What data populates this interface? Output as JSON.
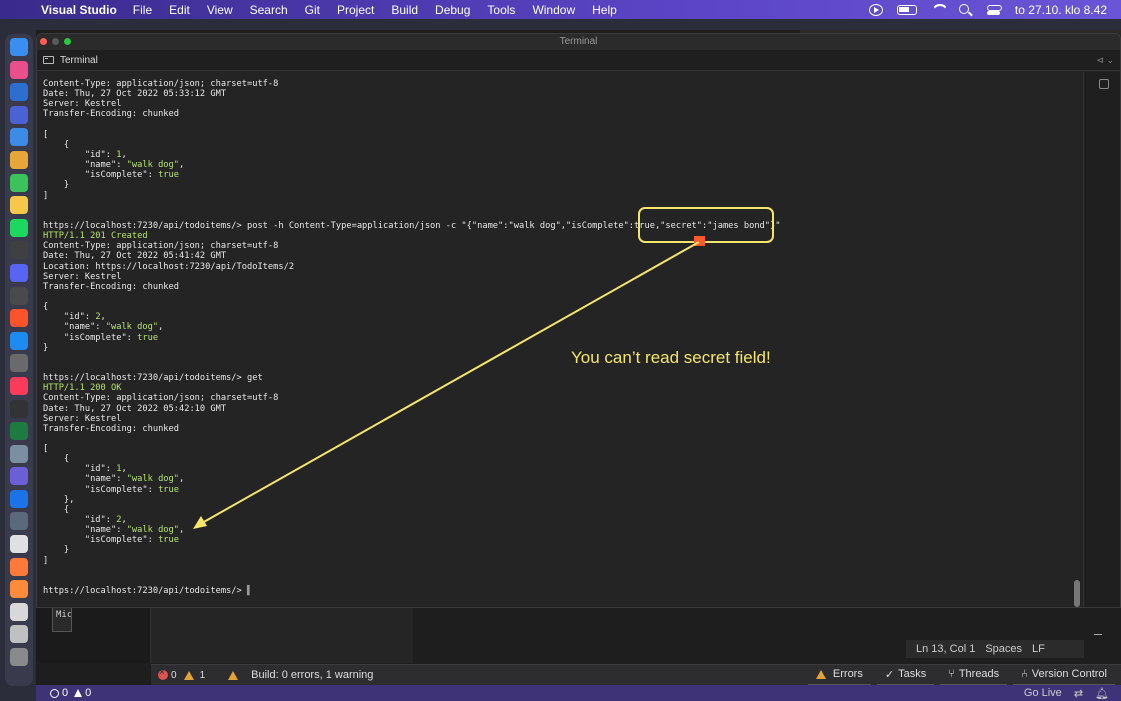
{
  "menubar": {
    "app_name": "Visual Studio",
    "items": [
      "File",
      "Edit",
      "View",
      "Search",
      "Git",
      "Project",
      "Build",
      "Debug",
      "Tools",
      "Window",
      "Help"
    ],
    "clock": "to 27.10. klo 8.42"
  },
  "dock": {
    "colors": [
      "#3a8ef0",
      "#e94f8b",
      "#2d6fd1",
      "#4b62d6",
      "#3c8be5",
      "#e6a73a",
      "#3bc25b",
      "#f5c84a",
      "#1ed760",
      "#404040",
      "#5865f2",
      "#4a4a4a",
      "#fb542b",
      "#1e8bf2",
      "#6a6a6a",
      "#fa3c5a",
      "#333333",
      "#1d7a43",
      "#7a8fa0",
      "#6c5fd6",
      "#1a73e8",
      "#5a6a7a",
      "#e0e0e0",
      "#ff7a3a",
      "#ff8a3a",
      "#d8d8d8",
      "#c0c0c0",
      "#8a8a8a"
    ]
  },
  "terminal": {
    "window_title": "Terminal",
    "tab_label": "Terminal",
    "lines": [
      [
        {
          "t": "Content-Type: application/json; charset=utf-8"
        }
      ],
      [
        {
          "t": "Date: Thu, 27 Oct 2022 05:33:12 GMT"
        }
      ],
      [
        {
          "t": "Server: Kestrel"
        }
      ],
      [
        {
          "t": "Transfer-Encoding: chunked"
        }
      ],
      [
        {
          "t": ""
        }
      ],
      [
        {
          "t": "["
        }
      ],
      [
        {
          "t": "    {"
        }
      ],
      [
        {
          "t": "        \"id\": "
        },
        {
          "t": "1",
          "c": "g"
        },
        {
          "t": ","
        }
      ],
      [
        {
          "t": "        \"name\": "
        },
        {
          "t": "\"walk dog\"",
          "c": "g"
        },
        {
          "t": ","
        }
      ],
      [
        {
          "t": "        \"isComplete\": "
        },
        {
          "t": "true",
          "c": "g"
        }
      ],
      [
        {
          "t": "    }"
        }
      ],
      [
        {
          "t": "]"
        }
      ],
      [
        {
          "t": ""
        }
      ],
      [
        {
          "t": ""
        }
      ],
      [
        {
          "t": "https://localhost:7230/api/todoitems/> post -h Content-Type=application/json -c \"{\"name\":\"walk dog\",\"isComplete\":true,\"secret\":\"james bond\"}\""
        }
      ],
      [
        {
          "t": "HTTP/1.1 201 Created",
          "c": "g"
        }
      ],
      [
        {
          "t": "Content-Type: application/json; charset=utf-8"
        }
      ],
      [
        {
          "t": "Date: Thu, 27 Oct 2022 05:41:42 GMT"
        }
      ],
      [
        {
          "t": "Location: https://localhost:7230/api/TodoItems/2"
        }
      ],
      [
        {
          "t": "Server: Kestrel"
        }
      ],
      [
        {
          "t": "Transfer-Encoding: chunked"
        }
      ],
      [
        {
          "t": ""
        }
      ],
      [
        {
          "t": "{"
        }
      ],
      [
        {
          "t": "    \"id\": "
        },
        {
          "t": "2",
          "c": "g"
        },
        {
          "t": ","
        }
      ],
      [
        {
          "t": "    \"name\": "
        },
        {
          "t": "\"walk dog\"",
          "c": "g"
        },
        {
          "t": ","
        }
      ],
      [
        {
          "t": "    \"isComplete\": "
        },
        {
          "t": "true",
          "c": "g"
        }
      ],
      [
        {
          "t": "}"
        }
      ],
      [
        {
          "t": ""
        }
      ],
      [
        {
          "t": ""
        }
      ],
      [
        {
          "t": "https://localhost:7230/api/todoitems/> get"
        }
      ],
      [
        {
          "t": "HTTP/1.1 200 OK",
          "c": "g"
        }
      ],
      [
        {
          "t": "Content-Type: application/json; charset=utf-8"
        }
      ],
      [
        {
          "t": "Date: Thu, 27 Oct 2022 05:42:10 GMT"
        }
      ],
      [
        {
          "t": "Server: Kestrel"
        }
      ],
      [
        {
          "t": "Transfer-Encoding: chunked"
        }
      ],
      [
        {
          "t": ""
        }
      ],
      [
        {
          "t": "["
        }
      ],
      [
        {
          "t": "    {"
        }
      ],
      [
        {
          "t": "        \"id\": "
        },
        {
          "t": "1",
          "c": "g"
        },
        {
          "t": ","
        }
      ],
      [
        {
          "t": "        \"name\": "
        },
        {
          "t": "\"walk dog\"",
          "c": "g"
        },
        {
          "t": ","
        }
      ],
      [
        {
          "t": "        \"isComplete\": "
        },
        {
          "t": "true",
          "c": "g"
        }
      ],
      [
        {
          "t": "    },"
        }
      ],
      [
        {
          "t": "    {"
        }
      ],
      [
        {
          "t": "        \"id\": "
        },
        {
          "t": "2",
          "c": "g"
        },
        {
          "t": ","
        }
      ],
      [
        {
          "t": "        \"name\": "
        },
        {
          "t": "\"walk dog\"",
          "c": "g"
        },
        {
          "t": ","
        }
      ],
      [
        {
          "t": "        \"isComplete\": "
        },
        {
          "t": "true",
          "c": "g"
        }
      ],
      [
        {
          "t": "    }"
        }
      ],
      [
        {
          "t": "]"
        }
      ],
      [
        {
          "t": ""
        }
      ],
      [
        {
          "t": ""
        }
      ],
      [
        {
          "t": "https://localhost:7230/api/todoitems/> "
        },
        {
          "t": "▌",
          "c": "cursor"
        }
      ]
    ]
  },
  "annotation": {
    "text": "You can’t read secret field!",
    "color": "#f4e66a"
  },
  "background_window": {
    "mic_text": "Mic",
    "editor_status": {
      "position": "Ln 13, Col 1",
      "indent": "Spaces",
      "line_ending": "LF"
    }
  },
  "build_bar": {
    "error_count": "0",
    "warning_count": "1",
    "build_status": "Build: 0 errors, 1 warning",
    "tabs": [
      "Errors",
      "Tasks",
      "Threads",
      "Version Control"
    ]
  },
  "status_bar": {
    "errors": "0",
    "warnings": "0",
    "go_live": "Go Live"
  },
  "colors": {
    "accent": "#5b45c6",
    "terminal_green": "#b7e36e",
    "annotation_yellow": "#f4e66a",
    "marker_orange": "#ff5a2c"
  }
}
